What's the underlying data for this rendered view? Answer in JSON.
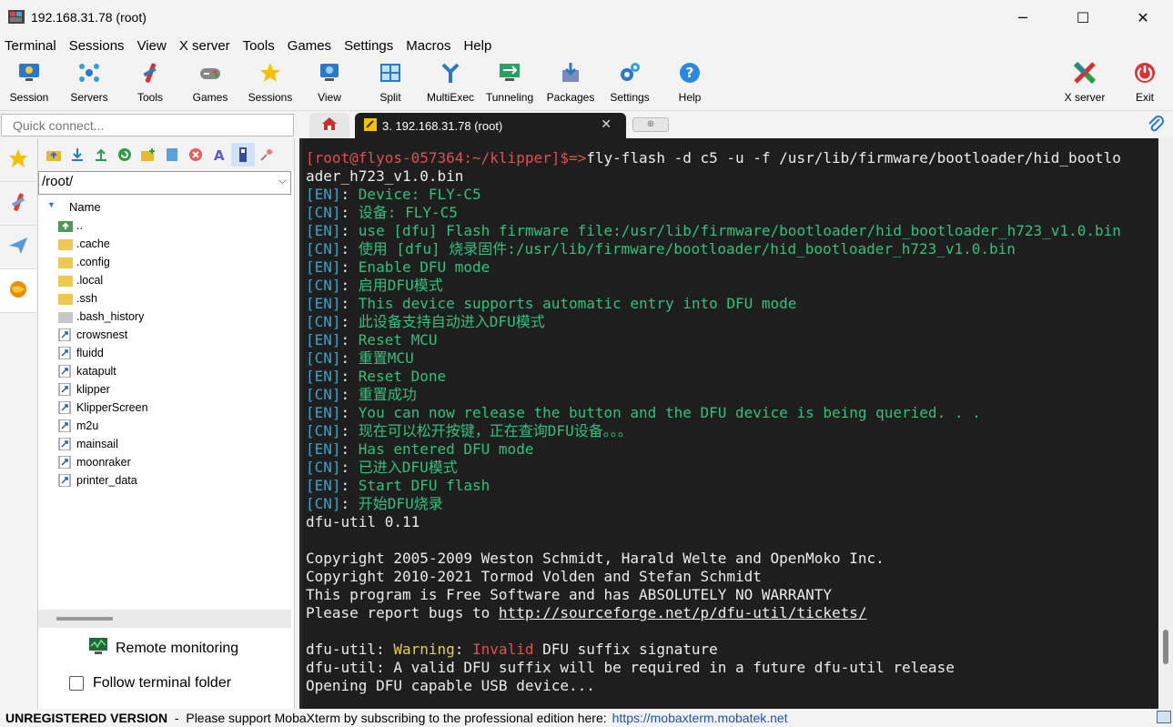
{
  "window": {
    "title": "192.168.31.78 (root)",
    "minimize": "─",
    "maximize": "☐",
    "close": "✕"
  },
  "menu": [
    "Terminal",
    "Sessions",
    "View",
    "X server",
    "Tools",
    "Games",
    "Settings",
    "Macros",
    "Help"
  ],
  "toolbar": {
    "session": "Session",
    "servers": "Servers",
    "tools": "Tools",
    "games": "Games",
    "sessions": "Sessions",
    "view": "View",
    "split": "Split",
    "multiexec": "MultiExec",
    "tunneling": "Tunneling",
    "packages": "Packages",
    "settings": "Settings",
    "help": "Help",
    "xserver": "X server",
    "exit": "Exit"
  },
  "quick_connect": {
    "placeholder": "Quick connect..."
  },
  "tabs": {
    "active_label": "3. 192.168.31.78 (root)",
    "close": "✕"
  },
  "sidebar": {
    "path": "/root/",
    "column_header": "Name",
    "items": [
      "..",
      ".cache",
      ".config",
      ".local",
      ".ssh",
      ".bash_history",
      "crowsnest",
      "fluidd",
      "katapult",
      "klipper",
      "KlipperScreen",
      "m2u",
      "mainsail",
      "moonraker",
      "printer_data"
    ],
    "remote_monitoring": "Remote monitoring",
    "follow_terminal_folder": "Follow terminal folder"
  },
  "terminal": {
    "prompt": "[root@flyos-057364:~/klipper]$=>",
    "command": "fly-flash -d c5 -u -f /usr/lib/firmware/bootloader/hid_bootlo",
    "command_wrap": "ader_h723_v1.0.bin",
    "msgs": [
      {
        "tag": "[EN]",
        "text": "Device: FLY-C5"
      },
      {
        "tag": "[CN]",
        "text": "设备: FLY-C5"
      },
      {
        "tag": "[EN]",
        "text": "use [dfu] Flash firmware file:/usr/lib/firmware/bootloader/hid_bootloader_h723_v1.0.bin"
      },
      {
        "tag": "[CN]",
        "text": "使用 [dfu] 烧录固件:/usr/lib/firmware/bootloader/hid_bootloader_h723_v1.0.bin"
      },
      {
        "tag": "[EN]",
        "text": "Enable DFU mode"
      },
      {
        "tag": "[CN]",
        "text": "启用DFU模式"
      },
      {
        "tag": "[EN]",
        "text": "This device supports automatic entry into DFU mode"
      },
      {
        "tag": "[CN]",
        "text": "此设备支持自动进入DFU模式"
      },
      {
        "tag": "[EN]",
        "text": "Reset MCU"
      },
      {
        "tag": "[CN]",
        "text": "重置MCU"
      },
      {
        "tag": "[EN]",
        "text": "Reset Done"
      },
      {
        "tag": "[CN]",
        "text": "重置成功"
      },
      {
        "tag": "[EN]",
        "text": "You can now release the button and the DFU device is being queried. . ."
      },
      {
        "tag": "[CN]",
        "text": "现在可以松开按键，正在查询DFU设备。。。"
      },
      {
        "tag": "[EN]",
        "text": "Has entered DFU mode"
      },
      {
        "tag": "[CN]",
        "text": "已进入DFU模式"
      },
      {
        "tag": "[EN]",
        "text": "Start DFU flash"
      },
      {
        "tag": "[CN]",
        "text": "开始DFU烧录"
      }
    ],
    "version": "dfu-util 0.11",
    "copyright1": "Copyright 2005-2009 Weston Schmidt, Harald Welte and OpenMoko Inc.",
    "copyright2": "Copyright 2010-2021 Tormod Volden and Stefan Schmidt",
    "warranty": "This program is Free Software and has ABSOLUTELY NO WARRANTY",
    "bugs_prefix": "Please report bugs to ",
    "bugs_url": "http://sourceforge.net/p/dfu-util/tickets/",
    "warn_prefix": "dfu-util: ",
    "warn_word": "Warning",
    "warn_colon": ": ",
    "warn_invalid": "Invalid",
    "warn_rest": " DFU suffix signature",
    "valid_line": "dfu-util: A valid DFU suffix will be required in a future dfu-util release",
    "opening_line": "Opening DFU capable USB device..."
  },
  "status": {
    "unregistered": "UNREGISTERED VERSION",
    "message": "  -  Please support MobaXterm by subscribing to the professional edition here:",
    "link": "https://mobaxterm.mobatek.net"
  }
}
